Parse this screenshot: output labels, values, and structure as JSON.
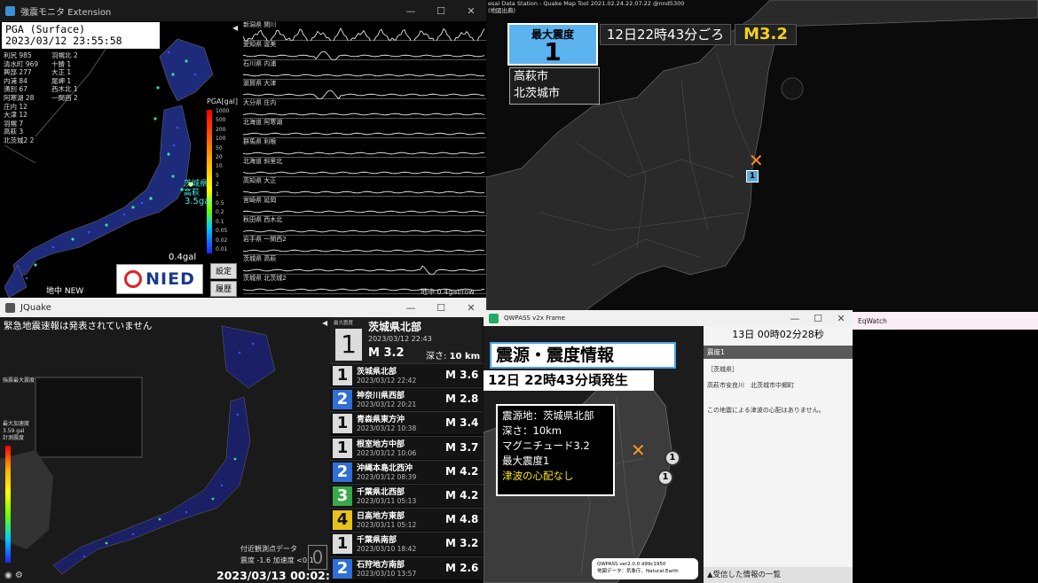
{
  "kyoshin": {
    "title": "強震モニタ Extension",
    "pga_title": "PGA (Surface)",
    "datetime": "2023/03/12 23:55:58",
    "stations": [
      "利尻 985",
      "羽幌北 2",
      "清水町 969",
      "十勝 1",
      "興部 277",
      "大正 1",
      "内浦 84",
      "尾岬 1",
      "湧別 67",
      "西木北 1",
      "阿寒湖 28",
      "一関西 2",
      "庄内 12",
      "",
      "大津 12",
      "",
      "羽幌 7",
      "",
      "高萩 3",
      "",
      "北茨城2 2",
      ""
    ],
    "scale_title": "PGA[gal]",
    "scale_ticks": [
      "1000",
      "500",
      "200",
      "100",
      "50",
      "20",
      "10",
      "5",
      "2",
      "1",
      "0.5",
      "0.2",
      "0.1",
      "0.05",
      "0.02",
      "0.01"
    ],
    "highlight_name": "茨城県\n高萩",
    "highlight_val": "3.5gal",
    "gal_value": "0.4gal",
    "logo": "NIED",
    "btn_settings": "設定",
    "btn_history": "履歴",
    "mode": "地中 NEW",
    "per_row": "地中 0.4gal/row",
    "wave_labels": [
      "新潟県 関川",
      "愛知県 渥美",
      "石川県 内浦",
      "滋賀県 大津",
      "大分県 庄内",
      "北海道 阿寒湖",
      "群馬県 利根",
      "北海道 斜里北",
      "高知県 大正",
      "宮崎県 延岡",
      "秋田県 西木北",
      "岩手県 一関西2",
      "茨城県 高萩",
      "茨城県 北茨城2"
    ]
  },
  "quake_map": {
    "header": "esai Data Station - Quake Map Tool 2021.02.24.22.07.22 @nnd5300\n(地図出典)",
    "max_label": "最大震度",
    "max_value": "1",
    "time": "12日22時43分ごろ",
    "magnitude": "M3.2",
    "areas": [
      "高萩市",
      "北茨城市"
    ],
    "epicenter_mark": "✕",
    "intensity_mark": "1"
  },
  "jquake": {
    "title": "JQuake",
    "eew_status": "緊急地震速報は発表されていません",
    "legend1": "強震最大震度",
    "legend2": "最大加速度\n3.59 gal\n計測震度",
    "near_title": "付近観測点データ",
    "near_values": "震度 -1.6  加速度 <0.1",
    "near_box": "0",
    "clock": "2023/03/13 00:02:26",
    "top": {
      "label": "最大震度",
      "int": "1",
      "region": "茨城県北部",
      "date": "2023/03/12 22:43",
      "mag": "M 3.2",
      "depth_label": "深さ:",
      "depth": "10 km"
    },
    "list": [
      {
        "int": "1",
        "region": "茨城県北部",
        "date": "2023/03/12 22:42",
        "mag": "M 3.6",
        "color": "#dcdcdc"
      },
      {
        "int": "2",
        "region": "神奈川県西部",
        "date": "2023/03/12 20:21",
        "mag": "M 2.8",
        "color": "#2f6fd6"
      },
      {
        "int": "1",
        "region": "青森県東方沖",
        "date": "2023/03/12 10:38",
        "mag": "M 3.4",
        "color": "#dcdcdc"
      },
      {
        "int": "1",
        "region": "根室地方中部",
        "date": "2023/03/12 10:06",
        "mag": "M 3.7",
        "color": "#dcdcdc"
      },
      {
        "int": "2",
        "region": "沖縄本島北西沖",
        "date": "2023/03/12 08:39",
        "mag": "M 4.2",
        "color": "#2f6fd6"
      },
      {
        "int": "3",
        "region": "千葉県北西部",
        "date": "2023/03/11 05:13",
        "mag": "M 4.2",
        "color": "#3aa84a"
      },
      {
        "int": "4",
        "region": "日高地方東部",
        "date": "2023/03/11 05:12",
        "mag": "M 4.8",
        "color": "#e8c21c"
      },
      {
        "int": "1",
        "region": "千葉県南部",
        "date": "2023/03/10 18:42",
        "mag": "M 3.2",
        "color": "#dcdcdc"
      },
      {
        "int": "2",
        "region": "石狩地方南部",
        "date": "2023/03/10 13:57",
        "mag": "M 2.6",
        "color": "#2f6fd6"
      }
    ]
  },
  "qwpass": {
    "title": "QWPASS v2x Frame",
    "heading": "震源・震度情報",
    "occurred": "12日 22時43分頃発生",
    "lines": [
      "震源地：茨城県北部",
      "深さ：10km",
      "マグニチュード3.2",
      "最大震度1"
    ],
    "tsunami": "津波の心配なし",
    "credit1": "QWPASS ver2.0.0 d99c1950",
    "credit2": "地図データ：気象庁、Natural Earth",
    "side_clock": "13日 00時02分28秒",
    "side_header": "震度1",
    "side_pref": "［茨城県］",
    "side_city": "高萩市安良川　北茨城市中郷町",
    "side_tsunami": "この地震による津波の心配はありません。",
    "side_footer": "▲受信した情報の一覧",
    "circle": "1",
    "x": "✕"
  },
  "eqwatch": {
    "title": "EqWatch"
  }
}
